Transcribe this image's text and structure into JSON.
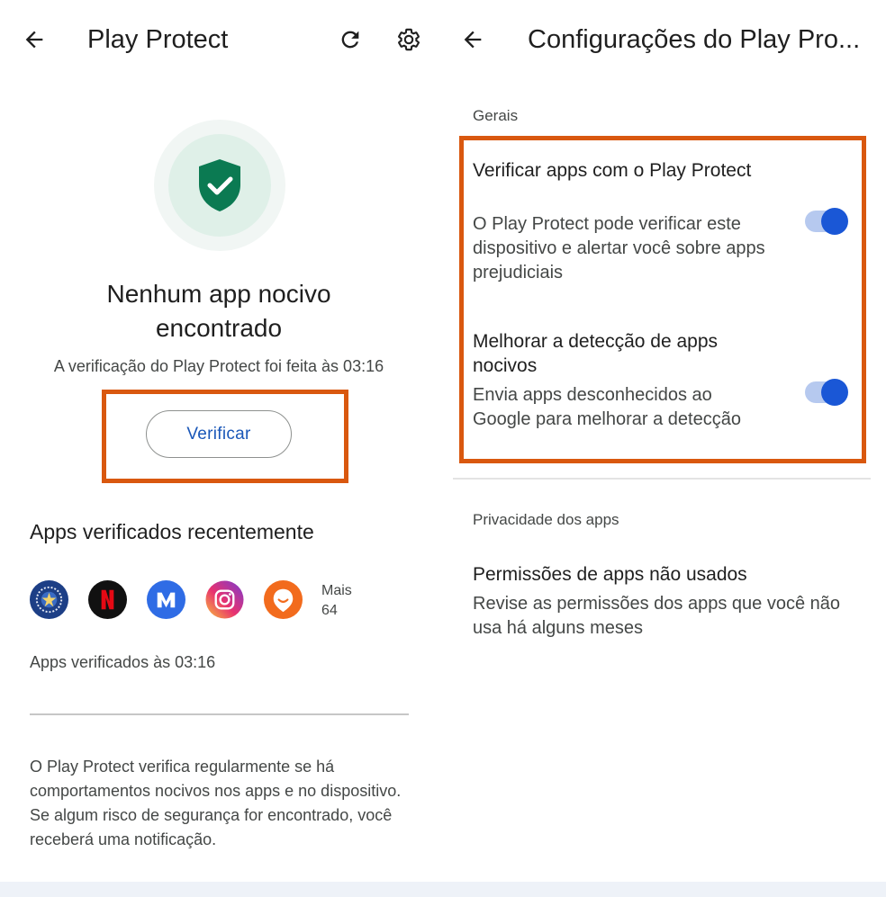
{
  "left": {
    "title": "Play Protect",
    "icons": {
      "back": "arrow-back-icon",
      "refresh": "refresh-icon",
      "settings": "gear-icon",
      "status": "shield-check-icon"
    },
    "headline_line1": "Nenhum app nocivo",
    "headline_line2": "encontrado",
    "scan_time": "A verificação do Play Protect foi feita às 03:16",
    "verify_button": "Verificar",
    "recent_section": "Apps verificados recentemente",
    "recent_apps": [
      {
        "icon": "gov-seal-app-icon"
      },
      {
        "icon": "netflix-app-icon"
      },
      {
        "icon": "m-app-icon"
      },
      {
        "icon": "instagram-app-icon"
      },
      {
        "icon": "moovit-app-icon"
      }
    ],
    "more_label": "Mais",
    "more_count": "64",
    "apps_time": "Apps verificados às 03:16",
    "footnote": "O Play Protect verifica regularmente se há comportamentos nocivos nos apps e no dispositivo. Se algum risco de segurança for encontrado, você receberá uma notificação."
  },
  "right": {
    "title": "Configurações do Play Pro...",
    "general_label": "Gerais",
    "settings": [
      {
        "title": "Verificar apps com o Play Protect",
        "desc": "O Play Protect pode verificar este dispositivo e alertar você sobre apps prejudiciais",
        "enabled": true
      },
      {
        "title": "Melhorar a detecção de apps nocivos",
        "desc": "Envia apps desconhecidos ao Google para melhorar a detecção",
        "enabled": true
      }
    ],
    "privacy_label": "Privacidade dos apps",
    "unused": {
      "title": "Permissões de apps não usados",
      "desc": "Revise as permissões dos apps que você não usa há alguns meses"
    }
  },
  "colors": {
    "highlight": "#d9580f",
    "accent": "#1a57b8",
    "toggle_on": "#1a57d6",
    "shield": "#0b7a52"
  }
}
